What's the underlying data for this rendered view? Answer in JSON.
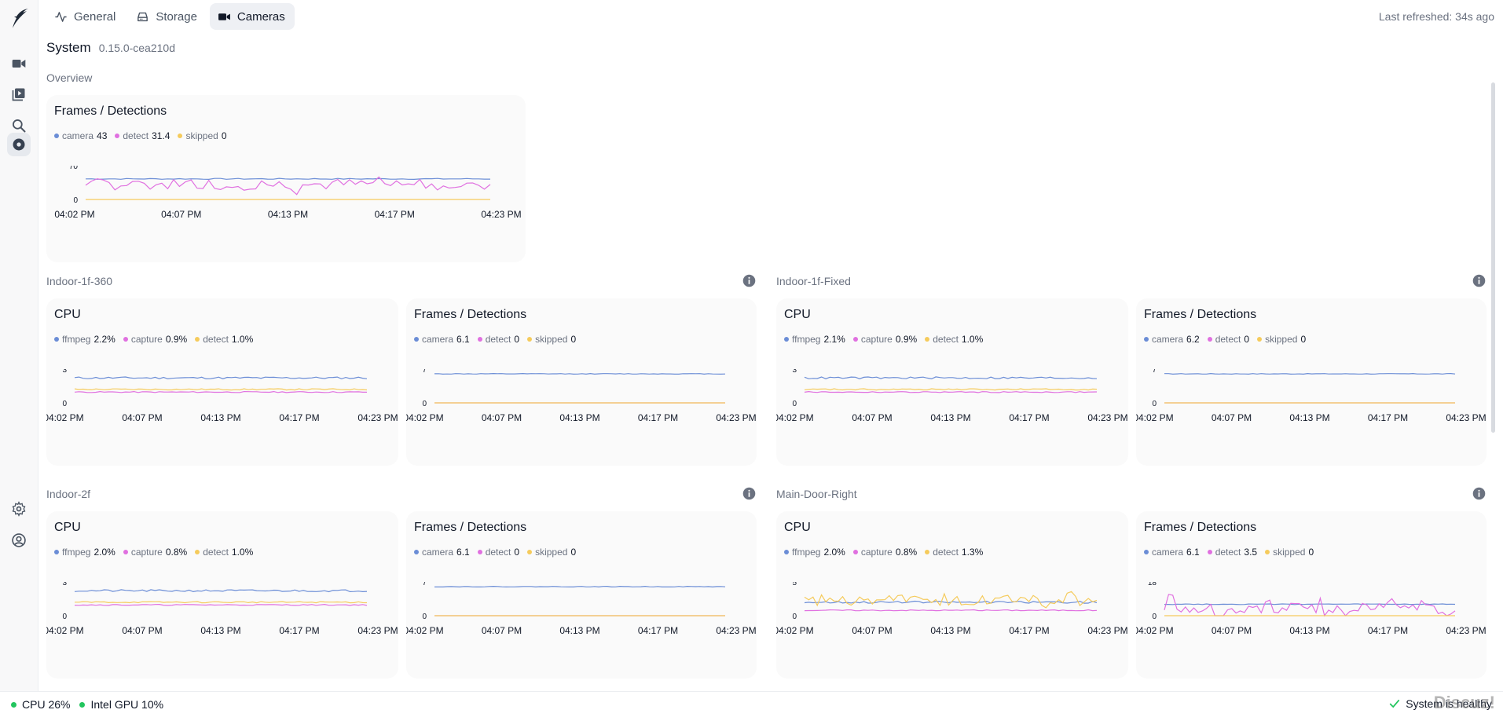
{
  "tabs": [
    {
      "label": "General",
      "icon": "activity-icon"
    },
    {
      "label": "Storage",
      "icon": "hard-drive-icon"
    },
    {
      "label": "Cameras",
      "icon": "video-icon",
      "active": true
    }
  ],
  "last_refreshed": "Last refreshed: 34s ago",
  "system": {
    "name": "System",
    "version": "0.15.0-cea210d"
  },
  "overview_label": "Overview",
  "nav_icons": [
    "video-camera-icon",
    "playlist-icon",
    "search-icon",
    "disc-icon",
    "gear-icon",
    "user-circle-icon"
  ],
  "colors": {
    "camera": "#6b8dd6",
    "ffmpeg": "#6b8dd6",
    "detect_frames": "#e070e0",
    "capture": "#e070e0",
    "skipped": "#f5cb5c",
    "detect_cpu": "#f5cb5c",
    "healthy": "#22c55e"
  },
  "time_ticks": [
    "04:02 PM",
    "04:07 PM",
    "04:13 PM",
    "04:17 PM",
    "04:23 PM"
  ],
  "overview": {
    "title": "Frames / Detections",
    "legend": [
      {
        "name": "camera",
        "value": "43"
      },
      {
        "name": "detect",
        "value": "31.4"
      },
      {
        "name": "skipped",
        "value": "0"
      }
    ],
    "ymax_label": "70",
    "ymin_label": "0"
  },
  "cameras": [
    {
      "name": "Indoor-1f-360",
      "cpu": {
        "title": "CPU",
        "legend": [
          {
            "name": "ffmpeg",
            "value": "2.2%"
          },
          {
            "name": "capture",
            "value": "0.9%"
          },
          {
            "name": "detect",
            "value": "1.0%"
          }
        ],
        "ymax_label": "3",
        "ymin_label": "0"
      },
      "frames": {
        "title": "Frames / Detections",
        "legend": [
          {
            "name": "camera",
            "value": "6.1"
          },
          {
            "name": "detect",
            "value": "0"
          },
          {
            "name": "skipped",
            "value": "0"
          }
        ],
        "ymax_label": "7",
        "ymin_label": "0"
      }
    },
    {
      "name": "Indoor-1f-Fixed",
      "cpu": {
        "title": "CPU",
        "legend": [
          {
            "name": "ffmpeg",
            "value": "2.1%"
          },
          {
            "name": "capture",
            "value": "0.9%"
          },
          {
            "name": "detect",
            "value": "1.0%"
          }
        ],
        "ymax_label": "3",
        "ymin_label": "0"
      },
      "frames": {
        "title": "Frames / Detections",
        "legend": [
          {
            "name": "camera",
            "value": "6.2"
          },
          {
            "name": "detect",
            "value": "0"
          },
          {
            "name": "skipped",
            "value": "0"
          }
        ],
        "ymax_label": "7",
        "ymin_label": "0"
      }
    },
    {
      "name": "Indoor-2f",
      "cpu": {
        "title": "CPU",
        "legend": [
          {
            "name": "ffmpeg",
            "value": "2.0%"
          },
          {
            "name": "capture",
            "value": "0.8%"
          },
          {
            "name": "detect",
            "value": "1.0%"
          }
        ],
        "ymax_label": "3",
        "ymin_label": "0"
      },
      "frames": {
        "title": "Frames / Detections",
        "legend": [
          {
            "name": "camera",
            "value": "6.1"
          },
          {
            "name": "detect",
            "value": "0"
          },
          {
            "name": "skipped",
            "value": "0"
          }
        ],
        "ymax_label": "7",
        "ymin_label": "0"
      }
    },
    {
      "name": "Main-Door-Right",
      "cpu": {
        "title": "CPU",
        "legend": [
          {
            "name": "ffmpeg",
            "value": "2.0%"
          },
          {
            "name": "capture",
            "value": "0.8%"
          },
          {
            "name": "detect",
            "value": "1.3%"
          }
        ],
        "ymax_label": "5",
        "ymin_label": "0"
      },
      "frames": {
        "title": "Frames / Detections",
        "legend": [
          {
            "name": "camera",
            "value": "6.1"
          },
          {
            "name": "detect",
            "value": "3.5"
          },
          {
            "name": "skipped",
            "value": "0"
          }
        ],
        "ymax_label": "18",
        "ymin_label": "0"
      }
    }
  ],
  "footer": {
    "cpu": "CPU 26%",
    "gpu": "Intel GPU 10%",
    "status": "System is healthy",
    "watermark": "Discuz!"
  }
}
